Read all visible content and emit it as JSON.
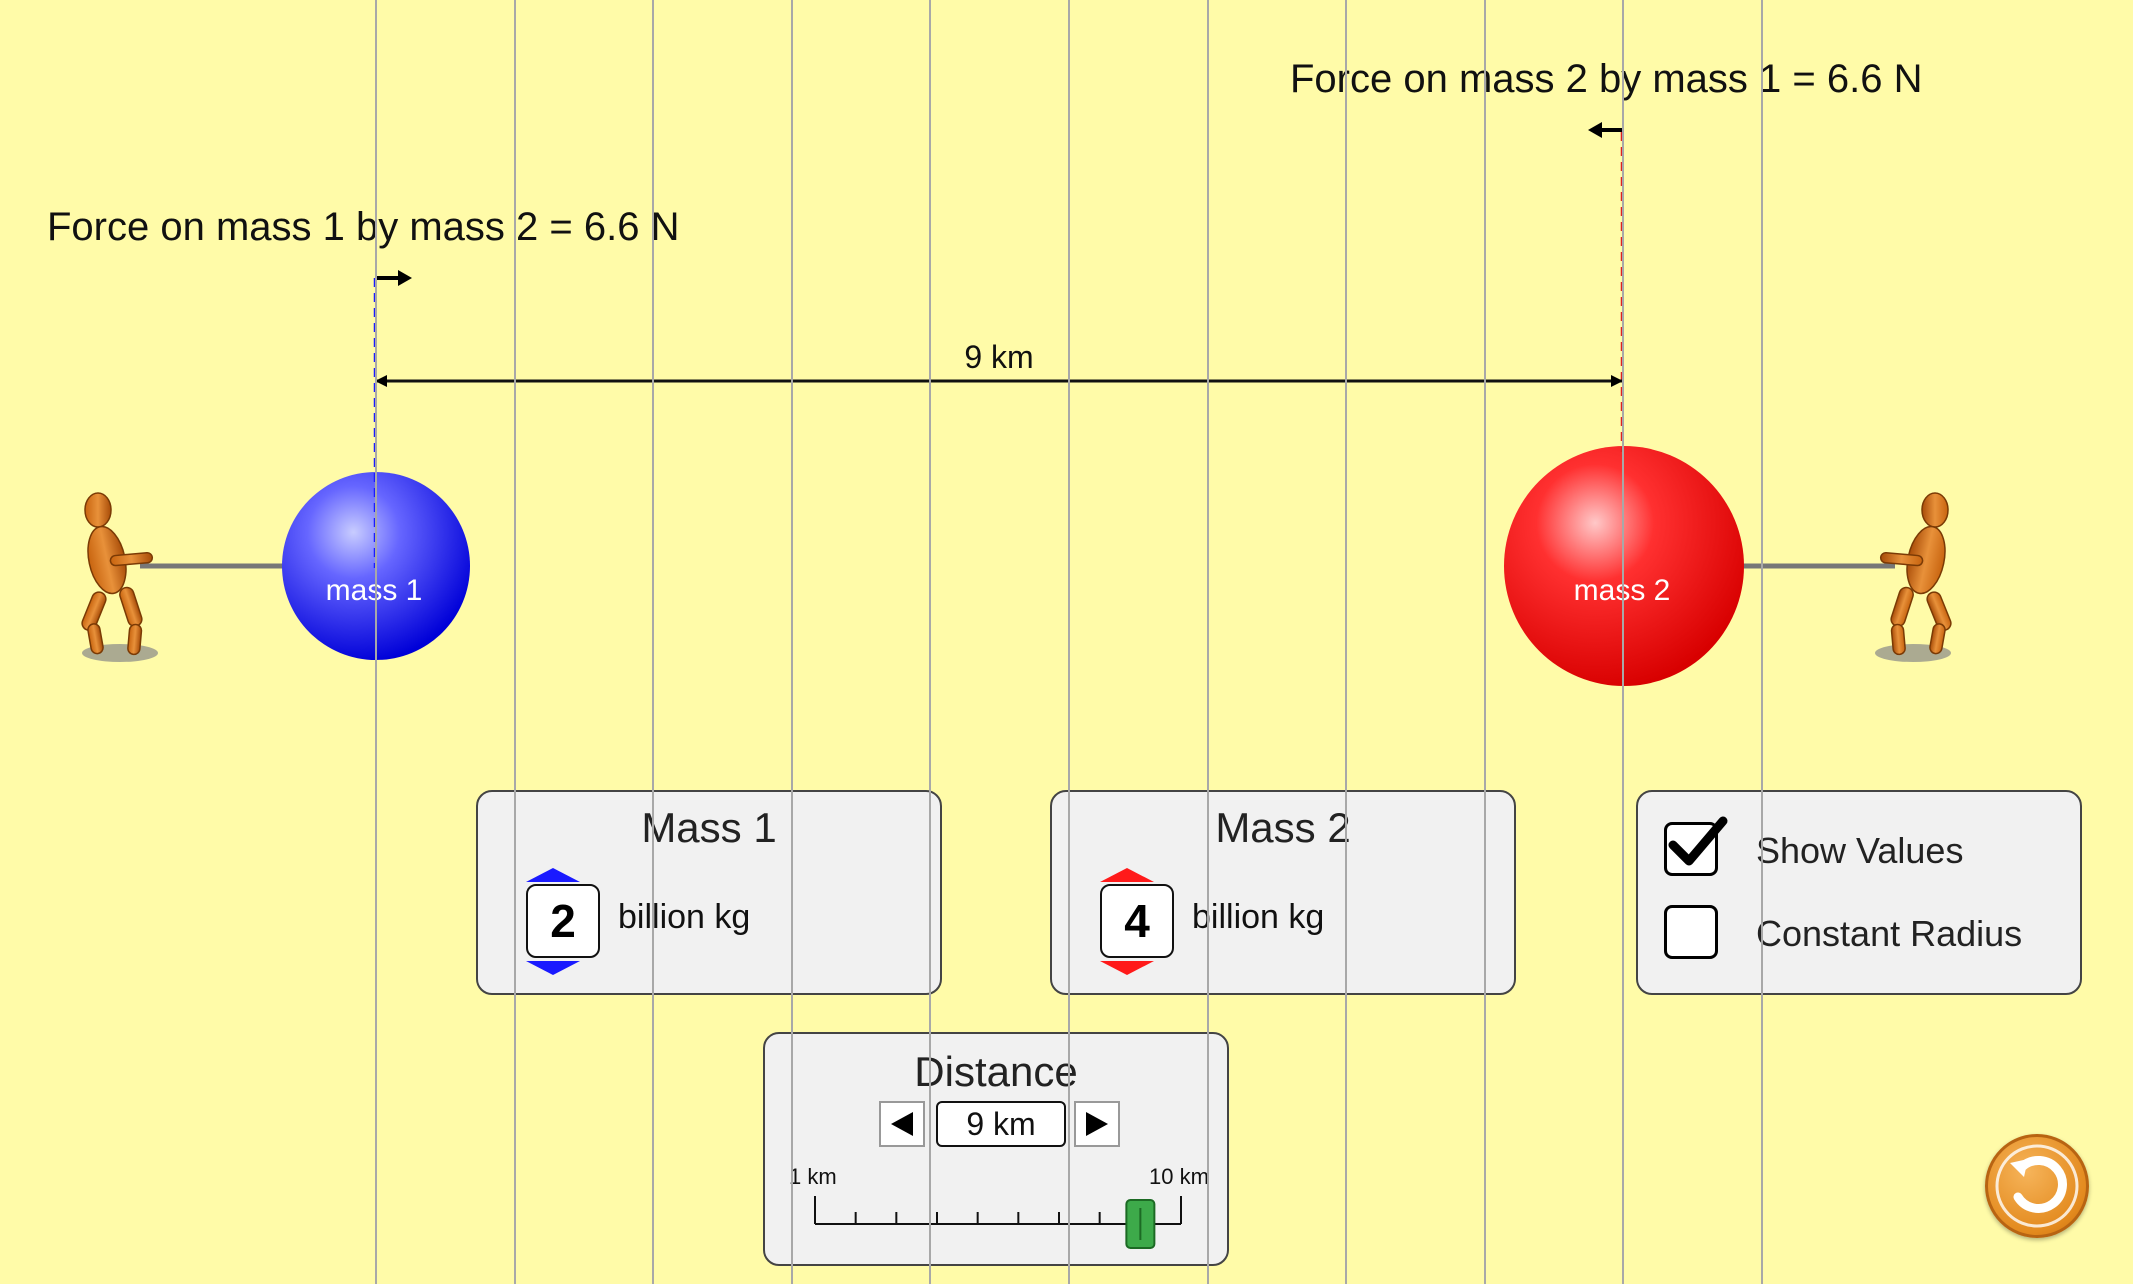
{
  "force_labels": {
    "on_mass1": "Force on mass 1 by mass 2 = 6.6 N",
    "on_mass2": "Force on mass 2 by mass 1 = 6.6 N"
  },
  "distance_label": "9 km",
  "masses": {
    "mass1": {
      "label": "mass 1",
      "color": "#1A1AFF"
    },
    "mass2": {
      "label": "mass 2",
      "color": "#FF0000"
    }
  },
  "mass1_panel": {
    "title": "Mass 1",
    "value": "2",
    "unit": "billion kg",
    "arrow_color": "#1A1AFF"
  },
  "mass2_panel": {
    "title": "Mass 2",
    "value": "4",
    "unit": "billion kg",
    "arrow_color": "#FF1A1A"
  },
  "options": {
    "show_values": {
      "label": "Show Values",
      "checked": true
    },
    "constant_radius": {
      "label": "Constant Radius",
      "checked": false
    }
  },
  "distance_panel": {
    "title": "Distance",
    "value": "9 km",
    "min_label": "1 km",
    "max_label": "10 km",
    "slider_fraction": 0.889,
    "thumb_color": "#3DAA4A"
  },
  "icons": {
    "reset": "reset-icon",
    "step_left": "triangle-left-icon",
    "step_right": "triangle-right-icon",
    "check": "checkmark-icon",
    "puller": "wooden-mannequin-icon"
  },
  "colors": {
    "background": "#FFFBA8",
    "grid_line": "#A8A8A8",
    "accent": "#E38A1E"
  }
}
